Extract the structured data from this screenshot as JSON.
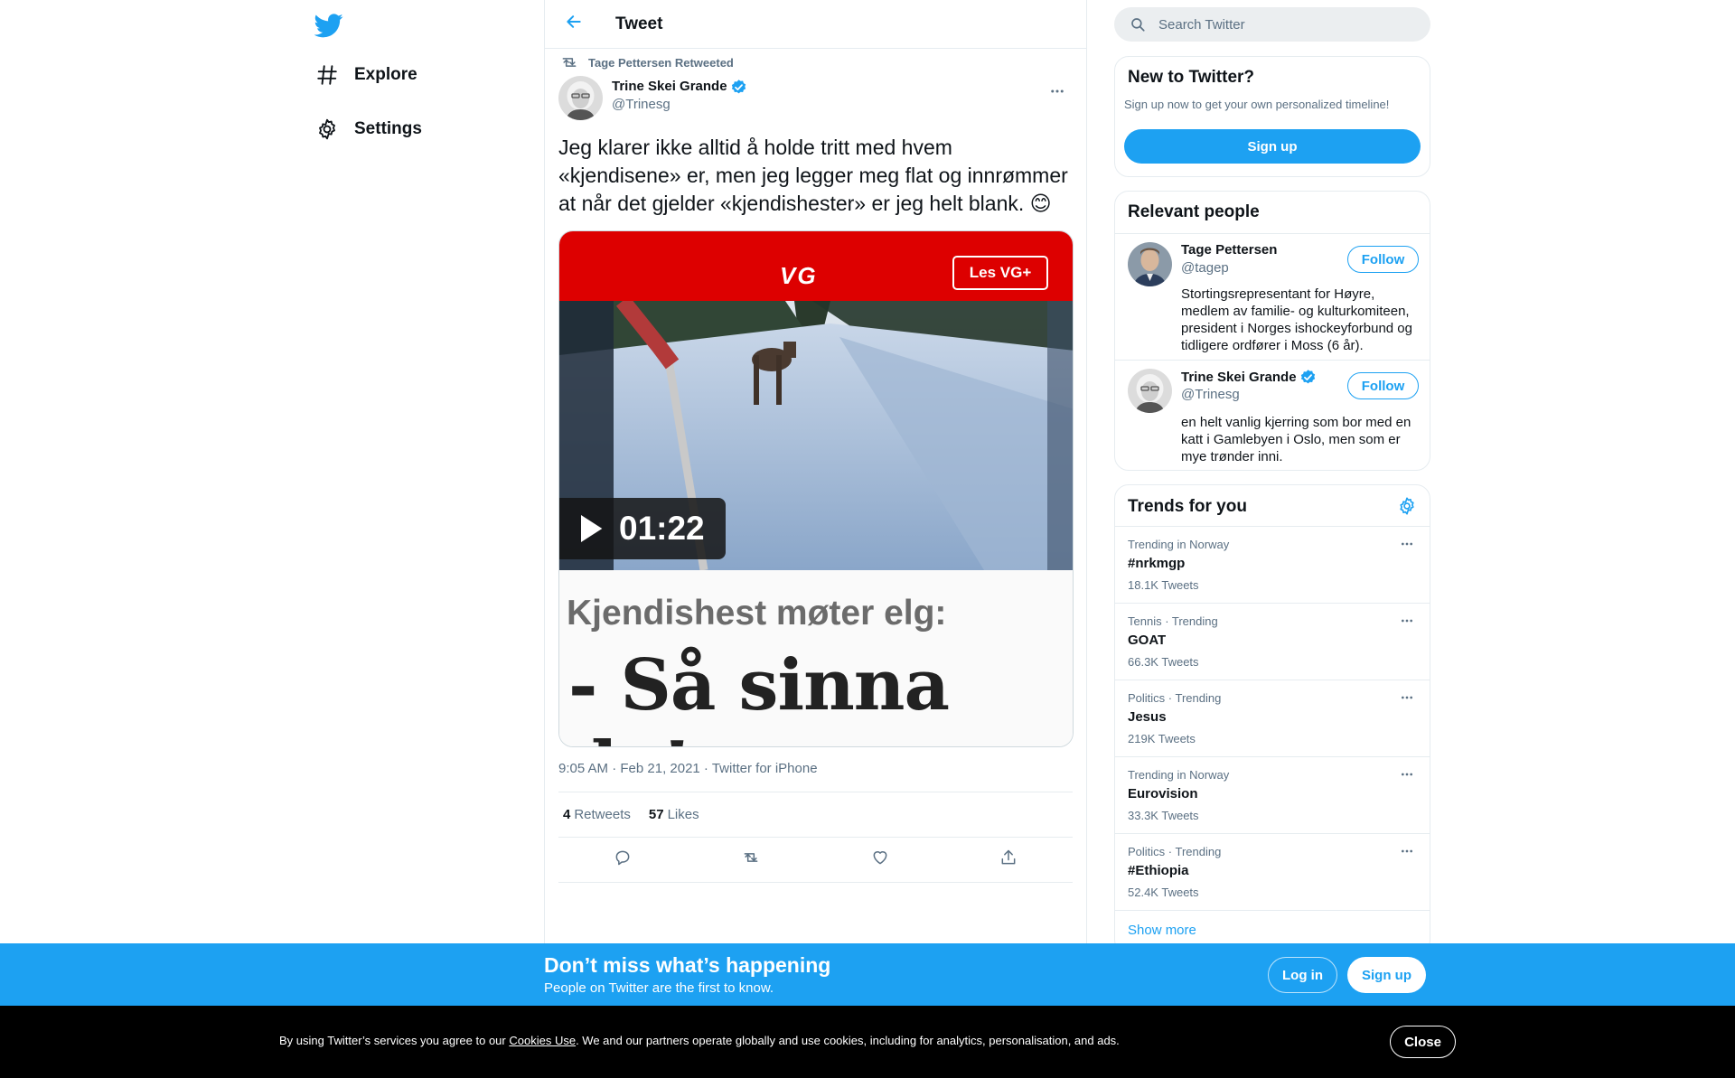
{
  "nav": {
    "logo": "twitter-bird-icon",
    "items": [
      {
        "label": "Explore",
        "icon": "hashtag-icon"
      },
      {
        "label": "Settings",
        "icon": "gear-icon"
      }
    ]
  },
  "header": {
    "title": "Tweet",
    "back_icon": "arrow-left-icon"
  },
  "tweet": {
    "retweeted_by": "Tage Pettersen Retweeted",
    "author_name": "Trine Skei Grande",
    "author_handle": "@Trinesg",
    "text": "Jeg klarer ikke alltid å holde tritt med hvem «kjendisene» er, men jeg legger meg flat og innrømmer at når det gjelder «kjendishester» er jeg helt blank. 😊",
    "media": {
      "brand": "VG",
      "brand_button": "Les VG+",
      "duration": "01:22",
      "kicker": "Kjendishest møter elg:",
      "headline": "- Så sinna da!"
    },
    "timestamp": "9:05 AM · Feb 21, 2021 · Twitter for iPhone",
    "retweets_count": "4",
    "retweets_label": "Retweets",
    "likes_count": "57",
    "likes_label": "Likes"
  },
  "search": {
    "placeholder": "Search Twitter"
  },
  "new_to_twitter": {
    "title": "New to Twitter?",
    "subtitle": "Sign up now to get your own personalized timeline!",
    "button": "Sign up"
  },
  "relevant_people": {
    "title": "Relevant people",
    "people": [
      {
        "name": "Tage Pettersen",
        "handle": "@tagep",
        "verified": false,
        "bio": "Stortingsrepresentant for Høyre, medlem av familie- og kulturkomiteen, president i Norges ishockeyforbund og tidligere ordfører i Moss (6 år).",
        "follow": "Follow"
      },
      {
        "name": "Trine Skei Grande",
        "handle": "@Trinesg",
        "verified": true,
        "bio": "en helt vanlig kjerring som bor med en katt i Gamlebyen i Oslo, men som er mye trønder inni.",
        "follow": "Follow"
      }
    ]
  },
  "trends": {
    "title": "Trends for you",
    "items": [
      {
        "context": "Trending in Norway",
        "name": "#nrkmgp",
        "count": "18.1K Tweets"
      },
      {
        "context": "Tennis · Trending",
        "name": "GOAT",
        "count": "66.3K Tweets"
      },
      {
        "context": "Politics · Trending",
        "name": "Jesus",
        "count": "219K Tweets"
      },
      {
        "context": "Trending in Norway",
        "name": "Eurovision",
        "count": "33.3K Tweets"
      },
      {
        "context": "Politics · Trending",
        "name": "#Ethiopia",
        "count": "52.4K Tweets"
      }
    ],
    "show_more": "Show more"
  },
  "signup_bar": {
    "title": "Don’t miss what’s happening",
    "subtitle": "People on Twitter are the first to know.",
    "login": "Log in",
    "signup": "Sign up"
  },
  "cookie_bar": {
    "prefix": "By using Twitter’s services you agree to our ",
    "link": "Cookies Use",
    "suffix": ". We and our partners operate globally and use cookies, including for analytics, personalisation, and ads.",
    "close": "Close"
  },
  "colors": {
    "accent": "#1da1f2",
    "text": "#0f1419",
    "secondary": "#5b7083",
    "vg_red": "#dd0000"
  }
}
